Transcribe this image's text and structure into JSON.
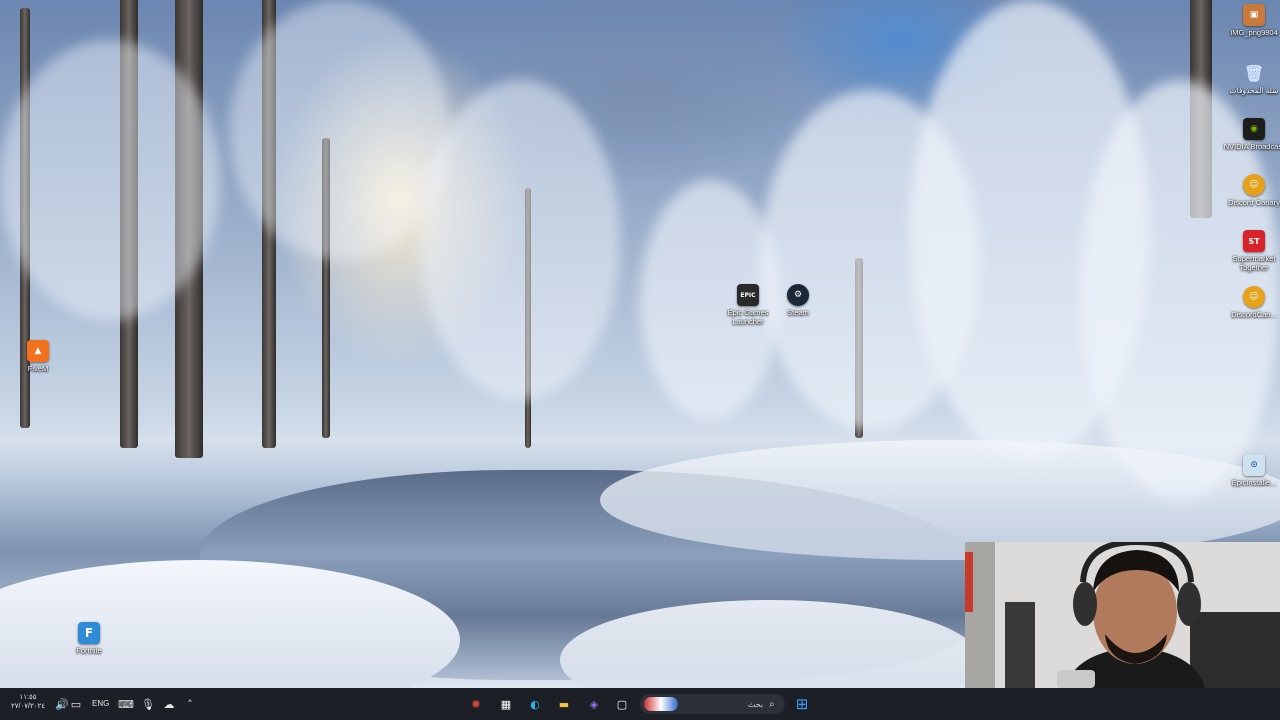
{
  "desktop_icons": [
    {
      "id": "img",
      "label": "IMG_png9804",
      "icon": "image-file-icon",
      "color": "#c97a3a"
    },
    {
      "id": "recycle",
      "label": "سلة المحذوفات",
      "icon": "recycle-bin-icon",
      "color": "#5a8fd6"
    },
    {
      "id": "nvidia",
      "label": "NVIDIA Broadcast",
      "icon": "nvidia-icon",
      "color": "#76b900"
    },
    {
      "id": "discord-canary",
      "label": "Discord Canary",
      "icon": "discord-canary-icon",
      "color": "#e6a21a"
    },
    {
      "id": "supermarket",
      "label": "Supermarket Together",
      "icon": "supermarket-together-icon",
      "color": "#d8232a"
    },
    {
      "id": "discordcan",
      "label": "DiscordCan...",
      "icon": "discord-canary-icon",
      "color": "#e6a21a"
    },
    {
      "id": "epicinstaller",
      "label": "EpicInstalle...",
      "icon": "installer-icon",
      "color": "#5aa0d8"
    },
    {
      "id": "epic",
      "label": "Epic Games Launcher",
      "icon": "epic-games-icon",
      "color": "#2a2a2a",
      "glyph": "EPIC"
    },
    {
      "id": "steam",
      "label": "Steam",
      "icon": "steam-icon",
      "color": "#1b2838"
    },
    {
      "id": "fivem",
      "label": "FiveM",
      "icon": "fivem-icon",
      "color": "#f2711c"
    },
    {
      "id": "fortnite",
      "label": "Fortnite",
      "icon": "fortnite-icon",
      "color": "#2f8bd6",
      "glyph": "F"
    }
  ],
  "taskbar": {
    "clock_time": "١١:٥٥",
    "clock_date": "٢٧/٠٧/٢٠٢٤",
    "language": "ENG",
    "search_placeholder": "بحث",
    "tray_icons": [
      "volume-icon",
      "display-icon",
      "keyboard-icon",
      "microphone-icon",
      "onedrive-icon",
      "chevron-up-icon"
    ],
    "pinned_apps": [
      "bug-app-icon",
      "store-icon",
      "edge-icon",
      "file-explorer-icon",
      "copilot-icon",
      "notepad-icon"
    ],
    "start_icon": "windows-start-icon"
  }
}
